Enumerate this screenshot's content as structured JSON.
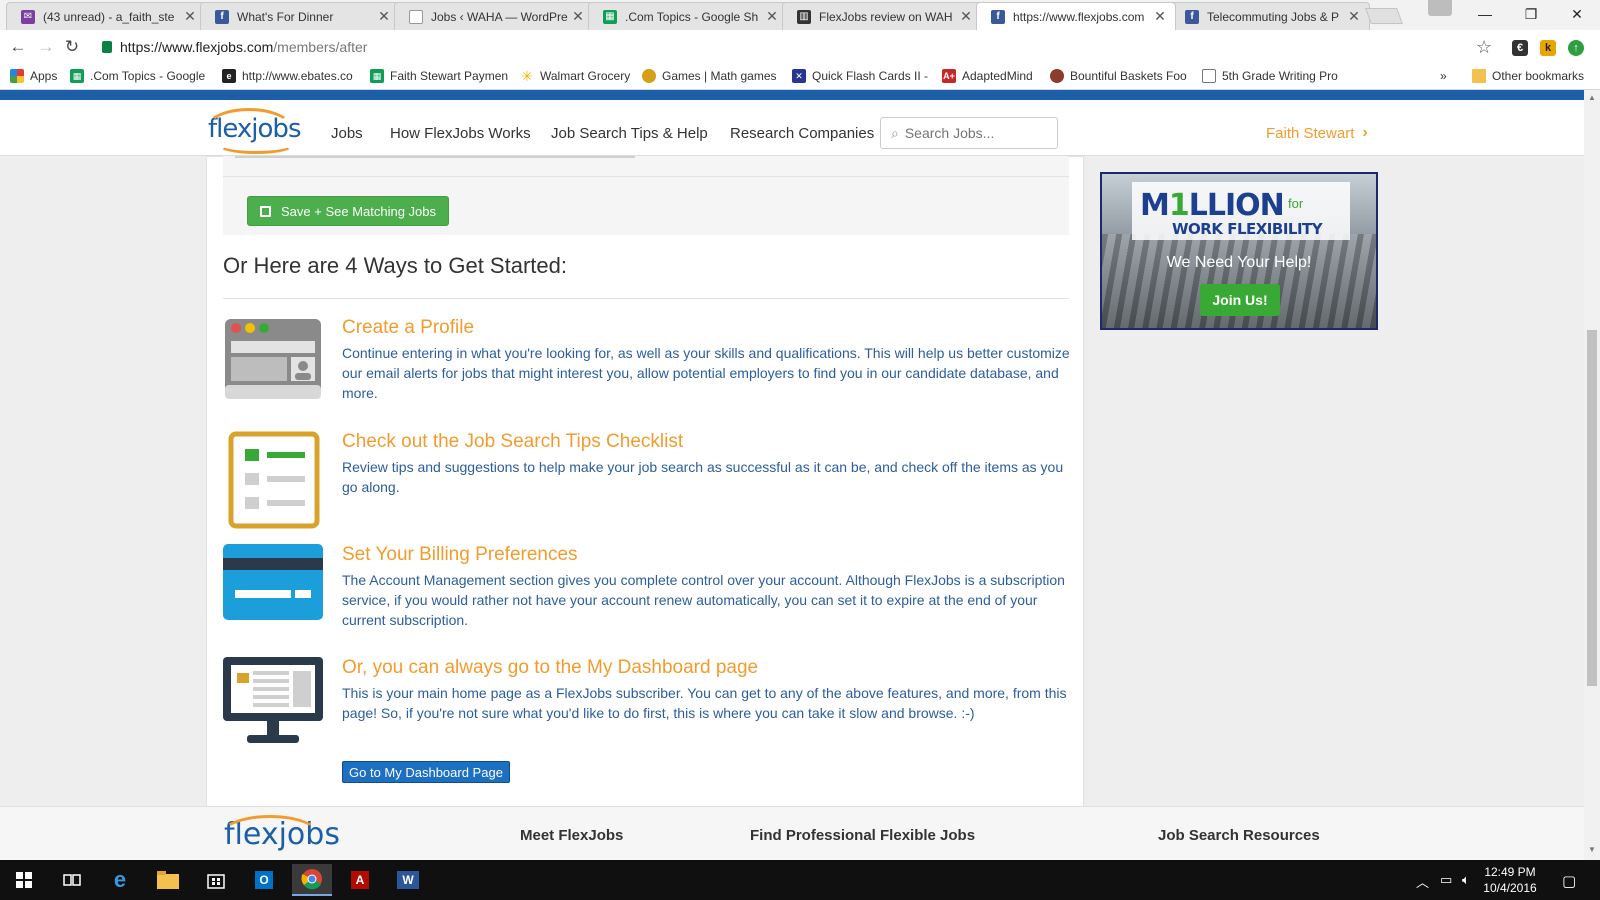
{
  "browser": {
    "tabs": [
      {
        "title": "(43 unread) - a_faith_ste",
        "icon": "mail-icon",
        "color": "#7b3fa0"
      },
      {
        "title": "What's For Dinner",
        "icon": "facebook-icon",
        "color": "#3b5998"
      },
      {
        "title": "Jobs ‹ WAHA — WordPre",
        "icon": "page-icon",
        "color": "#999999"
      },
      {
        "title": ".Com Topics - Google Sh",
        "icon": "sheets-icon",
        "color": "#0f9d58"
      },
      {
        "title": "FlexJobs review on WAH",
        "icon": "trello-icon",
        "color": "#333333"
      },
      {
        "title": "https://www.flexjobs.com",
        "icon": "facebook-icon",
        "color": "#3b5998"
      },
      {
        "title": "Telecommuting Jobs & P",
        "icon": "facebook-icon",
        "color": "#3b5998"
      }
    ],
    "active_tab": 5,
    "url_host": "https://www.flexjobs.com",
    "url_path": "/members/after",
    "bookmarks": [
      {
        "label": "Apps",
        "icon": "apps-grid-icon",
        "color": "#e53935"
      },
      {
        "label": ".Com Topics - Google",
        "icon": "sheets-icon",
        "color": "#0f9d58"
      },
      {
        "label": "http://www.ebates.co",
        "icon": "ebates-icon",
        "color": "#222222"
      },
      {
        "label": "Faith Stewart Paymen",
        "icon": "sheets-icon",
        "color": "#0f9d58"
      },
      {
        "label": "Walmart Grocery",
        "icon": "walmart-spark-icon",
        "color": "#f2b705"
      },
      {
        "label": "Games | Math games",
        "icon": "coin-icon",
        "color": "#d4a017"
      },
      {
        "label": "Quick Flash Cards II -",
        "icon": "x-box-icon",
        "color": "#283593"
      },
      {
        "label": "AdaptedMind",
        "icon": "a-plus-icon",
        "color": "#c62828"
      },
      {
        "label": "Bountiful Baskets Foo",
        "icon": "basket-icon",
        "color": "#8d3b2f"
      },
      {
        "label": "5th Grade Writing Pro",
        "icon": "page-icon",
        "color": "#777777"
      }
    ],
    "bookmarks_overflow": "»",
    "other_bookmarks": "Other bookmarks"
  },
  "site": {
    "logo_text": "flexjobs",
    "nav": [
      "Jobs",
      "How FlexJobs Works",
      "Job Search Tips & Help",
      "Research Companies"
    ],
    "search_placeholder": "Search Jobs...",
    "user_name": "Faith Stewart",
    "accent_color": "#f39c2d",
    "brand_blue": "#1c5fa8"
  },
  "main": {
    "save_button": "Save + See Matching Jobs",
    "ways_heading": "Or Here are 4 Ways to Get Started:",
    "items": [
      {
        "title": "Create a Profile",
        "desc": "Continue entering in what you're looking for, as well as your skills and qualifications. This will help us better customize our email alerts for jobs that might interest you, allow potential employers to find you in our candidate database, and more.",
        "icon": "profile-window-icon"
      },
      {
        "title": "Check out the Job Search Tips Checklist",
        "desc": "Review tips and suggestions to help make your job search as successful as it can be, and check off the items as you go along.",
        "icon": "checklist-icon"
      },
      {
        "title": "Set Your Billing Preferences",
        "desc": "The Account Management section gives you complete control over your account. Although FlexJobs is a subscription service, if you would rather not have your account renew automatically, you can set it to expire at the end of your current subscription.",
        "icon": "credit-card-icon"
      },
      {
        "title": "Or, you can always go to the My Dashboard page",
        "desc": "This is your main home page as a FlexJobs subscriber. You can get to any of the above features, and more, from this page! So, if you're not sure what you'd like to do first, this is where you can take it slow and browse. :-)",
        "icon": "monitor-dashboard-icon"
      }
    ],
    "dashboard_button": "Go to My Dashboard Page"
  },
  "ad": {
    "headline_pre": "M",
    "headline_one": "1",
    "headline_post": "LLION",
    "for": "for",
    "subline": "WORK FLEXIBILITY",
    "help": "We Need Your Help!",
    "join": "Join Us!"
  },
  "footer": {
    "logo_text": "flexjobs",
    "headings": [
      "Meet FlexJobs",
      "Find Professional Flexible Jobs",
      "Job Search Resources"
    ]
  },
  "taskbar": {
    "time": "12:49 PM",
    "date": "10/4/2016"
  }
}
